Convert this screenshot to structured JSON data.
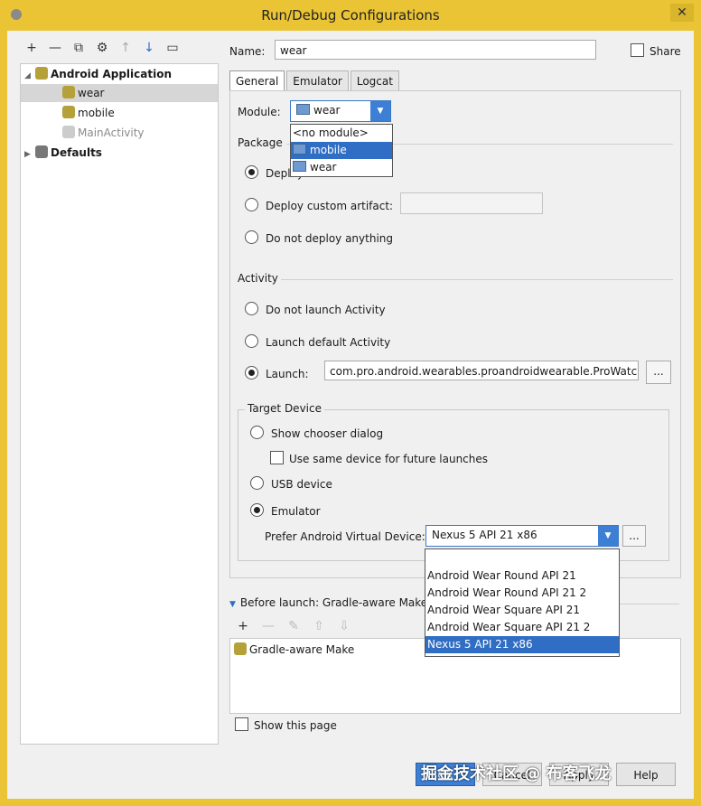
{
  "window": {
    "title": "Run/Debug Configurations",
    "close_label": "✕"
  },
  "toolbar": {
    "icons": [
      "add-icon",
      "remove-icon",
      "copy-icon",
      "settings-icon",
      "up-icon",
      "down-icon",
      "folder-icon"
    ],
    "add": "+",
    "remove": "—",
    "up": "↑",
    "down": "↓"
  },
  "tree": {
    "android_application": "Android Application",
    "wear": "wear",
    "mobile": "mobile",
    "main_activity": "MainActivity",
    "defaults": "Defaults"
  },
  "name_label": "Name:",
  "name_value": "wear",
  "share_label": "Share",
  "tabs": [
    "General",
    "Emulator",
    "Logcat"
  ],
  "module": {
    "label": "Module:",
    "selected": "wear",
    "options": [
      "<no module>",
      "mobile",
      "wear"
    ],
    "highlighted": "mobile"
  },
  "package": {
    "label": "Package",
    "deploy_default": "Deploy",
    "deploy_custom": "Deploy custom artifact:",
    "no_deploy": "Do not deploy anything"
  },
  "activity": {
    "label": "Activity",
    "no_launch": "Do not launch Activity",
    "launch_default": "Launch default Activity",
    "launch": "Launch:",
    "launch_value": "com.pro.android.wearables.proandroidwearable.ProWatchFa",
    "browse": "..."
  },
  "target": {
    "label": "Target Device",
    "chooser": "Show chooser dialog",
    "same_device": "Use same device for future launches",
    "usb": "USB device",
    "emulator": "Emulator",
    "prefer_label": "Prefer Android Virtual Device:",
    "prefer_value": "Nexus 5 API 21 x86",
    "browse": "...",
    "avd_options": [
      "Android Wear Round API 21",
      "Android Wear Round API 21 2",
      "Android Wear Square API 21",
      "Android Wear Square API 21 2",
      "Nexus 5 API 21 x86"
    ],
    "avd_highlighted": "Nexus 5 API 21 x86"
  },
  "before_launch": {
    "label": "Before launch: Gradle-aware Make",
    "item": "Gradle-aware Make",
    "show_page": "Show this page"
  },
  "buttons": {
    "ok": "OK",
    "cancel": "Cancel",
    "apply": "Apply",
    "help": "Help"
  },
  "watermark": "掘金技术社区 @ 布客飞龙"
}
